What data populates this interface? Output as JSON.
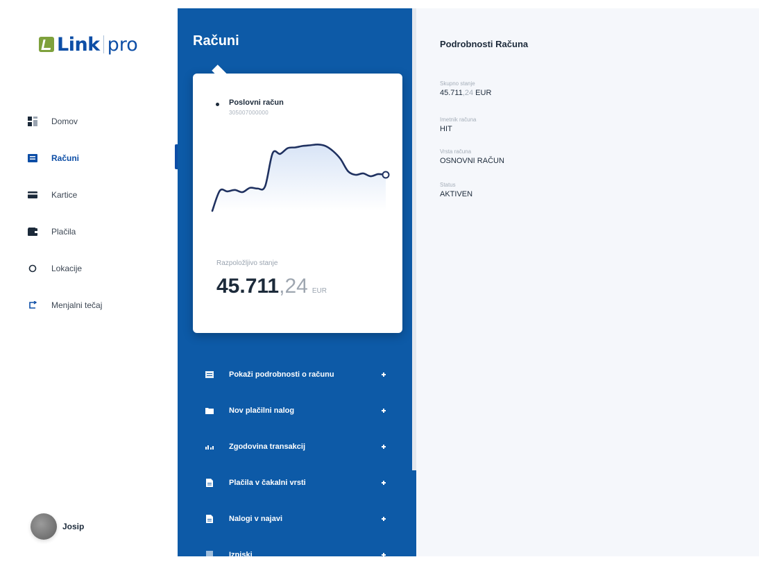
{
  "logo": {
    "brand": "Link",
    "suffix": "pro",
    "brand_color": "#0d4ea6",
    "mark_color": "#7ea13c"
  },
  "nav": {
    "active_index": 1,
    "items": [
      {
        "label": "Domov",
        "icon": "dashboard-icon"
      },
      {
        "label": "Računi",
        "icon": "accounts-icon"
      },
      {
        "label": "Kartice",
        "icon": "card-icon"
      },
      {
        "label": "Plačila",
        "icon": "wallet-icon"
      },
      {
        "label": "Lokacije",
        "icon": "location-icon"
      },
      {
        "label": "Menjalni tečaj",
        "icon": "exchange-icon"
      }
    ]
  },
  "user": {
    "name": "Josip"
  },
  "accounts": {
    "title": "Računi",
    "card": {
      "account_name": "Poslovni račun",
      "account_number": "305007000000",
      "balance_label": "Razpoložljivo stanje",
      "balance_integer": "45.711",
      "balance_decimal": ",24",
      "currency": "EUR"
    },
    "actions": [
      {
        "label": "Pokaži podrobnosti o računu",
        "icon": "list-icon"
      },
      {
        "label": "Nov plačilni nalog",
        "icon": "folder-icon"
      },
      {
        "label": "Zgodovina transakcij",
        "icon": "history-icon"
      },
      {
        "label": "Plačila v čakalni vrsti",
        "icon": "document-icon"
      },
      {
        "label": "Nalogi v najavi",
        "icon": "document-icon"
      },
      {
        "label": "Izpiski",
        "icon": "statement-icon"
      }
    ]
  },
  "details": {
    "title": "Podrobnosti Računa",
    "fields": [
      {
        "label": "Skupno stanje",
        "value_main": "45.711",
        "value_decimal": ",24",
        "value_suffix": " EUR"
      },
      {
        "label": "Imetnik računa",
        "value_main": "HIT",
        "value_decimal": "",
        "value_suffix": ""
      },
      {
        "label": "Vrsta računa",
        "value_main": "OSNOVNI RAČUN",
        "value_decimal": "",
        "value_suffix": ""
      },
      {
        "label": "Status",
        "value_main": "AKTIVEN",
        "value_decimal": "",
        "value_suffix": ""
      }
    ]
  },
  "colors": {
    "panel_blue": "#0d5aa7",
    "text_dark": "#1c2a3a",
    "line": "#1f3160"
  },
  "chart_data": {
    "type": "line",
    "x": [
      0,
      1,
      2,
      3,
      4,
      5,
      6,
      7,
      8,
      9,
      10,
      11,
      12,
      13,
      14,
      15,
      16,
      17,
      18,
      19,
      20,
      21,
      22,
      23
    ],
    "values": [
      0.0,
      0.28,
      0.27,
      0.29,
      0.26,
      0.32,
      0.31,
      0.34,
      0.8,
      0.79,
      0.87,
      0.88,
      0.9,
      0.91,
      0.92,
      0.9,
      0.83,
      0.72,
      0.55,
      0.5,
      0.52,
      0.48,
      0.51,
      0.5
    ],
    "ylim": [
      0,
      1
    ],
    "grid": false,
    "line_color": "#1f3160",
    "fill_color": "#d8e4f6"
  }
}
